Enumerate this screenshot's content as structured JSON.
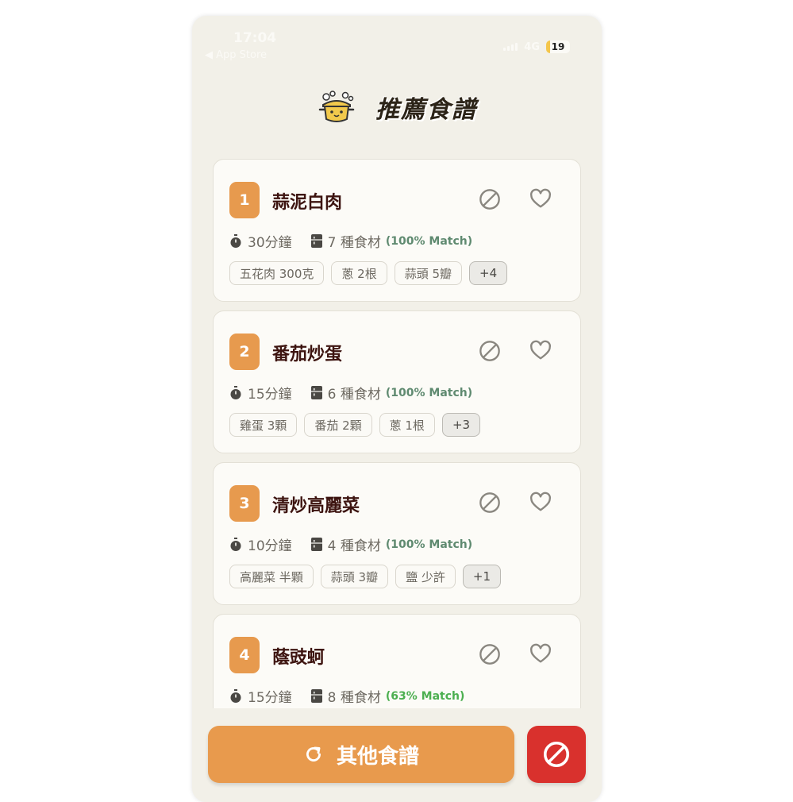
{
  "status": {
    "time": "17:04",
    "back_label": "◀ App Store",
    "network": "4G",
    "battery": "19"
  },
  "header": {
    "title": "推薦食譜",
    "icon": "pot-icon"
  },
  "recipes": [
    {
      "index": "1",
      "name": "蒜泥白肉",
      "time": "30分鐘",
      "ingredients": "7 種食材",
      "match": "(100% Match)",
      "match_color": "#5f8a70",
      "tags": [
        "五花肉 300克",
        "蔥 2根",
        "蒜頭 5瓣"
      ],
      "more": "+4"
    },
    {
      "index": "2",
      "name": "番茄炒蛋",
      "time": "15分鐘",
      "ingredients": "6 種食材",
      "match": "(100% Match)",
      "match_color": "#5f8a70",
      "tags": [
        "雞蛋 3顆",
        "番茄 2顆",
        "蔥 1根"
      ],
      "more": "+3"
    },
    {
      "index": "3",
      "name": "清炒高麗菜",
      "time": "10分鐘",
      "ingredients": "4 種食材",
      "match": "(100% Match)",
      "match_color": "#5f8a70",
      "tags": [
        "高麗菜 半顆",
        "蒜頭 3瓣",
        "鹽 少許"
      ],
      "more": "+1"
    },
    {
      "index": "4",
      "name": "蔭豉蚵",
      "time": "15分鐘",
      "ingredients": "8 種食材",
      "match": "(63% Match)",
      "match_color": "#4caf50",
      "tags": [],
      "more": ""
    }
  ],
  "footer": {
    "other_label": "其他食譜",
    "refresh_icon": "refresh-icon",
    "block_icon": "block-icon"
  },
  "colors": {
    "accent": "#e89a4d",
    "danger": "#d9312d",
    "background": "#f2f0e8",
    "card": "#fcfbf7",
    "title_text": "#3d1410"
  }
}
